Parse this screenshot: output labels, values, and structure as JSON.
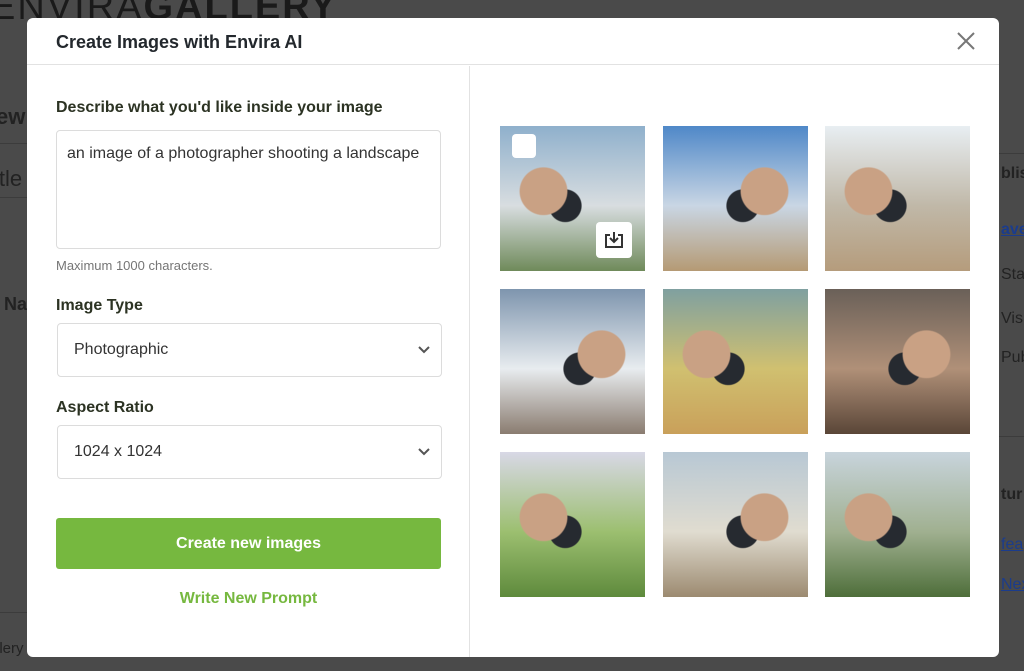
{
  "background": {
    "logo_light": "ENVIRA",
    "logo_bold": "GALLERY",
    "fragments_left": [
      "ew",
      "itle",
      "Na",
      "llery"
    ],
    "fragments_right": [
      "blish",
      "ave",
      "Sta",
      "Vis",
      "Pub",
      "tur",
      "fea",
      "Nex"
    ]
  },
  "modal": {
    "title": "Create Images with Envira AI",
    "close_icon": "close-icon",
    "prompt": {
      "label": "Describe what you'd like inside your image",
      "value": "an image of a photographer shooting a landscape",
      "hint": "Maximum 1000 characters."
    },
    "image_type": {
      "label": "Image Type",
      "selected": "Photographic"
    },
    "aspect_ratio": {
      "label": "Aspect Ratio",
      "selected": "1024 x 1024"
    },
    "create_button": "Create new images",
    "write_new_prompt": "Write New Prompt",
    "accent": "#76b83f",
    "images": [
      {
        "desc": "photographer-1",
        "c": [
          "#8fb0cc",
          "#d8dde0",
          "#6f8a5a"
        ]
      },
      {
        "desc": "photographer-2",
        "c": [
          "#4f88c8",
          "#c9d6e4",
          "#b59a74"
        ]
      },
      {
        "desc": "photographer-3",
        "c": [
          "#e8eef2",
          "#c0b8a8",
          "#b59c7c"
        ]
      },
      {
        "desc": "photographer-4",
        "c": [
          "#7e95ae",
          "#e8ecef",
          "#8a7c70"
        ]
      },
      {
        "desc": "photographer-5",
        "c": [
          "#7fa0a0",
          "#d0c070",
          "#c9a05a"
        ]
      },
      {
        "desc": "photographer-6",
        "c": [
          "#6a6058",
          "#b09078",
          "#5a4638"
        ]
      },
      {
        "desc": "photographer-7",
        "c": [
          "#d8d8e6",
          "#9cbf70",
          "#5e8a3c"
        ]
      },
      {
        "desc": "photographer-8",
        "c": [
          "#b8c8d4",
          "#e0dcd0",
          "#9c8a70"
        ]
      },
      {
        "desc": "photographer-9",
        "c": [
          "#c8d4dc",
          "#a0b090",
          "#4e6e3a"
        ]
      }
    ]
  }
}
